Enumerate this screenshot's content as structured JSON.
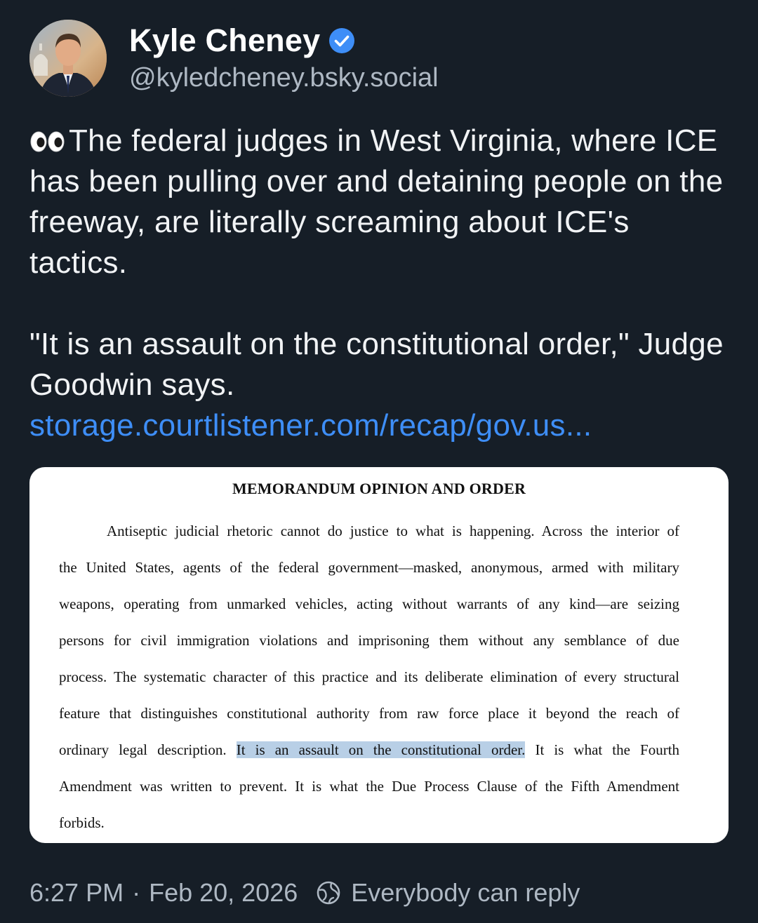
{
  "author": {
    "display_name": "Kyle Cheney",
    "handle": "@kyledcheney.bsky.social",
    "verified": true,
    "avatar_icon": "profile-photo"
  },
  "post": {
    "paragraph1": "The federal judges in West Virginia, where ICE has been pulling over and detaining people on the freeway, are literally screaming about ICE's tactics.",
    "paragraph2": "\"It is an assault on the constitutional order,\" Judge Goodwin says.",
    "link_text": "storage.courtlistener.com/recap/gov.us...",
    "emoji_icon": "eyes-emoji"
  },
  "embed": {
    "title": "MEMORANDUM OPINION AND ORDER",
    "lines": [
      "Antiseptic judicial rhetoric cannot do justice to what is happening. Across the interior of",
      "the United States, agents of the federal government—masked, anonymous, armed with military",
      "weapons, operating from unmarked vehicles, acting without warrants of any kind—are seizing",
      "persons for civil immigration violations and imprisoning them without any semblance of due",
      "process. The systematic character of this practice and its deliberate elimination of every structural",
      "feature that distinguishes constitutional authority from raw force place it beyond the reach of"
    ],
    "line7_before": "ordinary legal description.",
    "line7_highlight": "It is an assault on the constitutional order.",
    "line7_after": "It is what the Fourth",
    "line8": "Amendment was written to prevent. It is what the Due Process Clause of the Fifth Amendment",
    "line9": "forbids.",
    "highlight_color": "#b8cfe6"
  },
  "footer": {
    "time": "6:27 PM",
    "separator": "·",
    "date": "Feb 20, 2026",
    "reply_setting": "Everybody can reply",
    "reply_icon": "globe-icon"
  },
  "colors": {
    "background": "#161e27",
    "link": "#3e8ef7",
    "verified": "#3e8ef7",
    "muted_text": "#aeb8c3"
  }
}
